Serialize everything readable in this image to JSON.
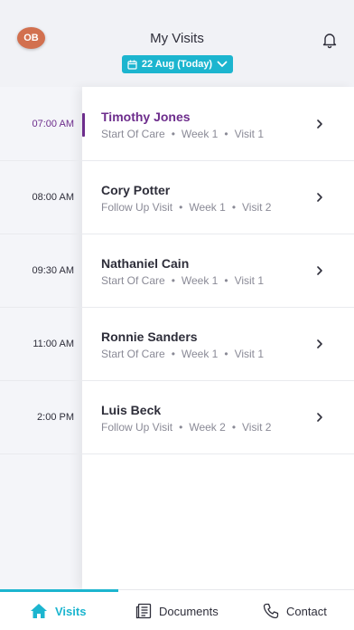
{
  "header": {
    "avatar_initials": "OB",
    "title": "My Visits",
    "date_label": "22 Aug (Today)",
    "notification_icon": "bell-icon"
  },
  "colors": {
    "accent": "#1cb5cf",
    "active_visit": "#6d2d8c",
    "avatar": "#d2704f"
  },
  "visits": [
    {
      "time": "07:00 AM",
      "name": "Timothy Jones",
      "type": "Start Of Care",
      "week": "Week 1",
      "visit": "Visit 1",
      "active": true
    },
    {
      "time": "08:00 AM",
      "name": "Cory Potter",
      "type": "Follow Up Visit",
      "week": "Week 1",
      "visit": "Visit 2",
      "active": false
    },
    {
      "time": "09:30 AM",
      "name": "Nathaniel Cain",
      "type": "Start Of Care",
      "week": "Week 1",
      "visit": "Visit 1",
      "active": false
    },
    {
      "time": "11:00 AM",
      "name": "Ronnie Sanders",
      "type": "Start Of Care",
      "week": "Week 1",
      "visit": "Visit 1",
      "active": false
    },
    {
      "time": "2:00 PM",
      "name": "Luis Beck",
      "type": "Follow Up Visit",
      "week": "Week 2",
      "visit": "Visit 2",
      "active": false
    }
  ],
  "tabs": [
    {
      "label": "Visits",
      "icon": "home-icon",
      "selected": true
    },
    {
      "label": "Documents",
      "icon": "documents-icon",
      "selected": false
    },
    {
      "label": "Contact",
      "icon": "phone-icon",
      "selected": false
    }
  ]
}
